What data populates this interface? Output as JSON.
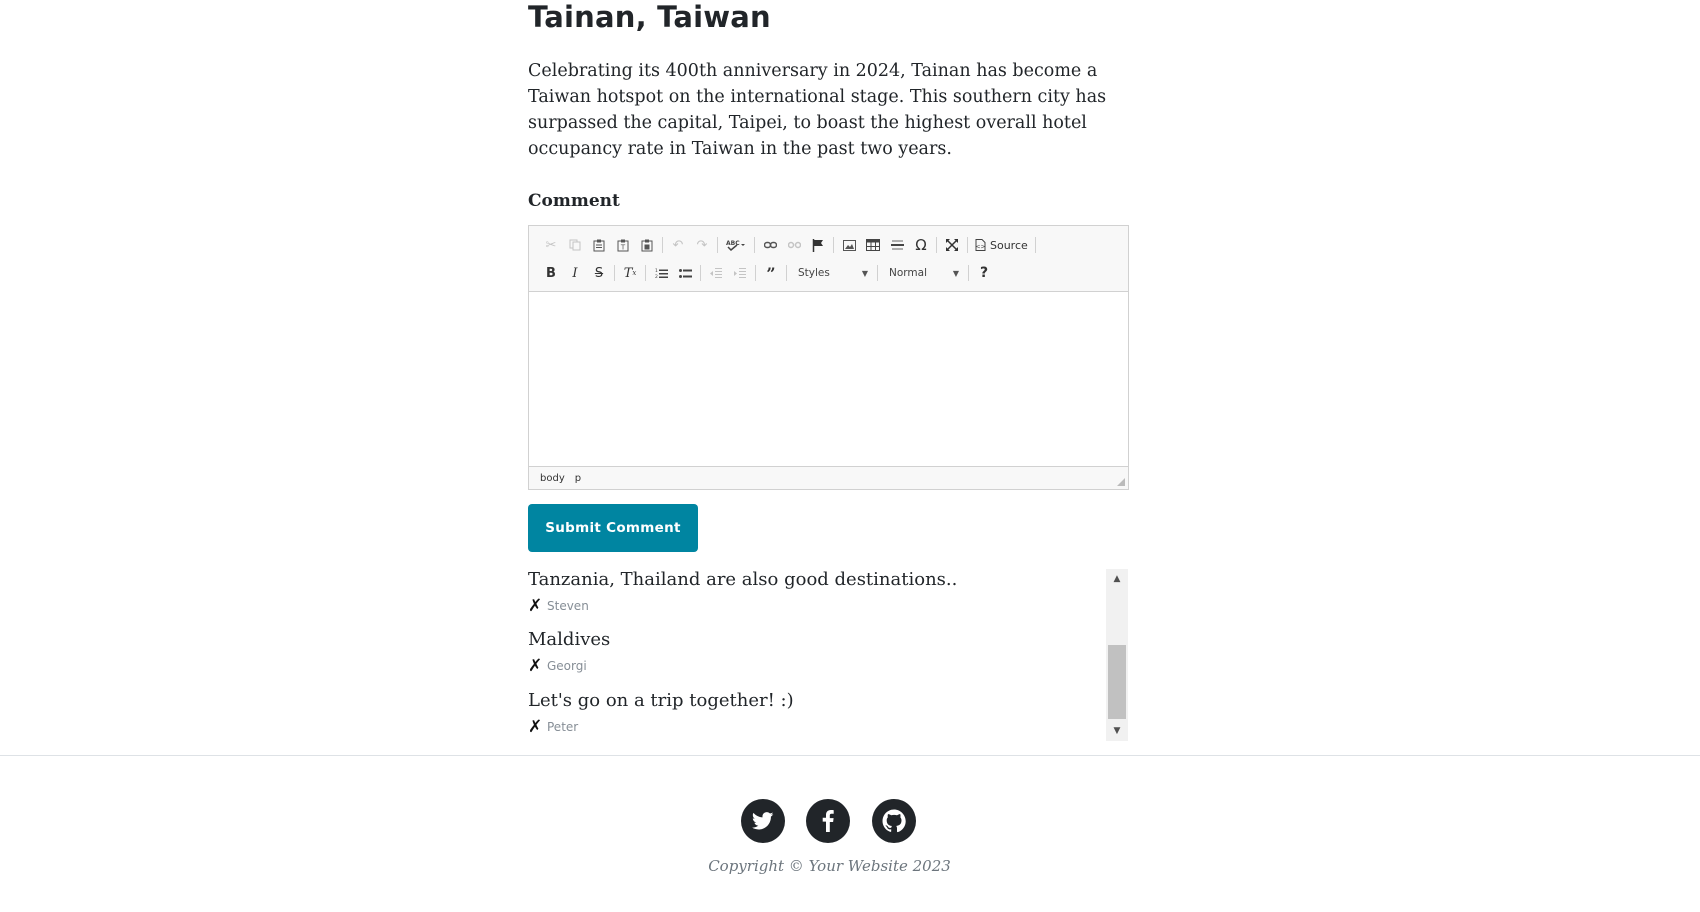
{
  "article": {
    "title": "Tainan, Taiwan",
    "paragraph": "Celebrating its 400th anniversary in 2024, Tainan has become a Taiwan hotspot on the international stage. This southern city has surpassed the capital, Taipei, to boast the highest overall hotel occupancy rate in Taiwan in the past two years."
  },
  "comment_form": {
    "label": "Comment",
    "toolbar": {
      "row1": [
        "cut-icon",
        "copy-icon",
        "paste-icon",
        "paste-text-icon",
        "paste-word-icon",
        "undo-icon",
        "redo-icon",
        "spellcheck-icon",
        "link-icon",
        "unlink-icon",
        "anchor-icon",
        "image-icon",
        "table-icon",
        "horizontal-line-icon",
        "special-char-icon",
        "maximize-icon"
      ],
      "source_label": "Source",
      "styles_label": "Styles",
      "format_label": "Normal",
      "row2": [
        "bold-icon",
        "italic-icon",
        "strike-icon",
        "remove-format-icon",
        "numbered-list-icon",
        "bulleted-list-icon",
        "outdent-icon",
        "indent-icon",
        "blockquote-icon",
        "help-icon"
      ]
    },
    "status_path": [
      "body",
      "p"
    ],
    "submit_label": "Submit Comment",
    "accent_color": "#0085a1"
  },
  "comments": [
    {
      "text": "Tanzania, Thailand are also good destinations..",
      "author": "Steven",
      "delete_icon": "✗"
    },
    {
      "text": "Maldives",
      "author": "Georgi",
      "delete_icon": "✗"
    },
    {
      "text": "Let's go on a trip together! :)",
      "author": "Peter",
      "delete_icon": "✗"
    }
  ],
  "footer": {
    "social": [
      "twitter-icon",
      "facebook-icon",
      "github-icon"
    ],
    "copyright": "Copyright © Your Website 2023"
  }
}
